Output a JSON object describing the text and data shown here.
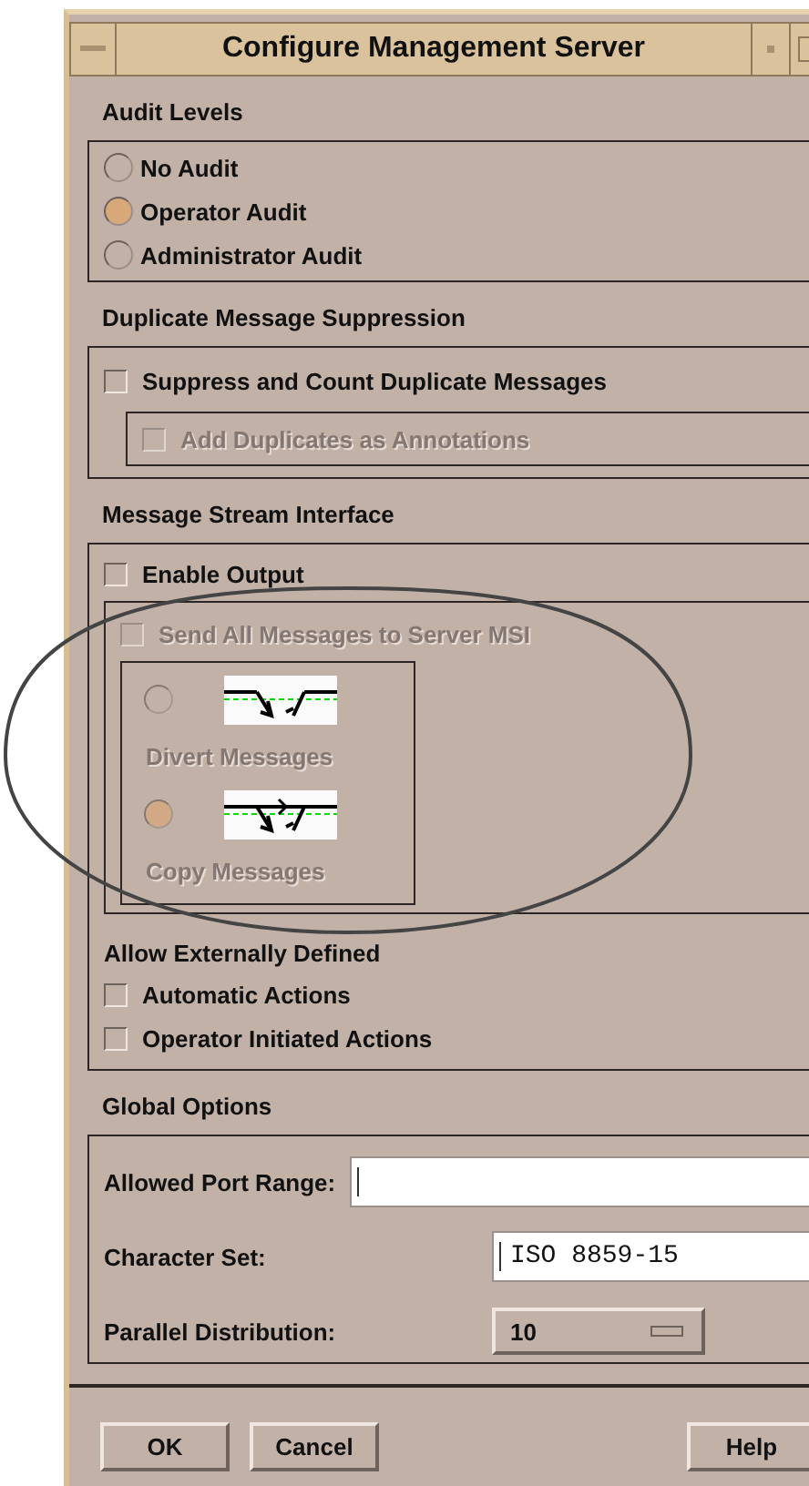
{
  "window": {
    "title": "Configure Management Server"
  },
  "audit_levels": {
    "heading": "Audit Levels",
    "options": [
      {
        "label": "No Audit",
        "selected": false
      },
      {
        "label": "Operator Audit",
        "selected": true
      },
      {
        "label": "Administrator Audit",
        "selected": false
      }
    ]
  },
  "duplicate_suppression": {
    "heading": "Duplicate Message Suppression",
    "suppress": {
      "label": "Suppress and Count Duplicate Messages",
      "checked": false
    },
    "annotations": {
      "label": "Add Duplicates as Annotations",
      "checked": false,
      "disabled": true
    }
  },
  "message_stream": {
    "heading": "Message Stream Interface",
    "enable_output": {
      "label": "Enable Output",
      "checked": false
    },
    "send_all": {
      "label": "Send All Messages to Server MSI",
      "checked": false,
      "disabled": true
    },
    "modes": [
      {
        "kind": "divert",
        "label": "Divert Messages",
        "selected": false,
        "disabled": true
      },
      {
        "kind": "copy",
        "label": "Copy Messages",
        "selected": true,
        "disabled": true
      }
    ],
    "external": {
      "heading": "Allow Externally Defined",
      "options": [
        {
          "label": "Automatic Actions",
          "checked": false
        },
        {
          "label": "Operator Initiated Actions",
          "checked": false
        }
      ]
    }
  },
  "global_options": {
    "heading": "Global Options",
    "fields": [
      {
        "kind": "text",
        "label": "Allowed Port Range:"
      },
      {
        "kind": "text",
        "label": "Character Set:",
        "value": "ISO 8859-15"
      },
      {
        "kind": "menu",
        "label": "Parallel Distribution:",
        "value": "10"
      }
    ]
  },
  "buttons": [
    "OK",
    "Cancel",
    "Help"
  ]
}
